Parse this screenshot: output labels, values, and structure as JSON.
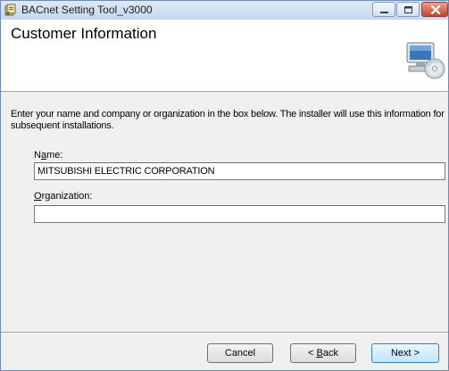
{
  "window": {
    "title": "BACnet Setting Tool_v3000",
    "minimize_label": "Minimize",
    "maximize_label": "Maximize",
    "close_label": "Close"
  },
  "banner": {
    "title": "Customer Information",
    "icon": "computer-cd-icon"
  },
  "instructions": "Enter your name and company or organization in the box below. The installer will use this information for subsequent installations.",
  "form": {
    "name_label_prefix": "N",
    "name_label_underlined": "a",
    "name_label_suffix": "me:",
    "name_value": "MITSUBISHI ELECTRIC CORPORATION",
    "org_label_underlined": "O",
    "org_label_suffix": "rganization:",
    "org_value": ""
  },
  "buttons": {
    "cancel": "Cancel",
    "back_prefix": "< ",
    "back_underlined": "B",
    "back_suffix": "ack",
    "next": "Next >"
  }
}
